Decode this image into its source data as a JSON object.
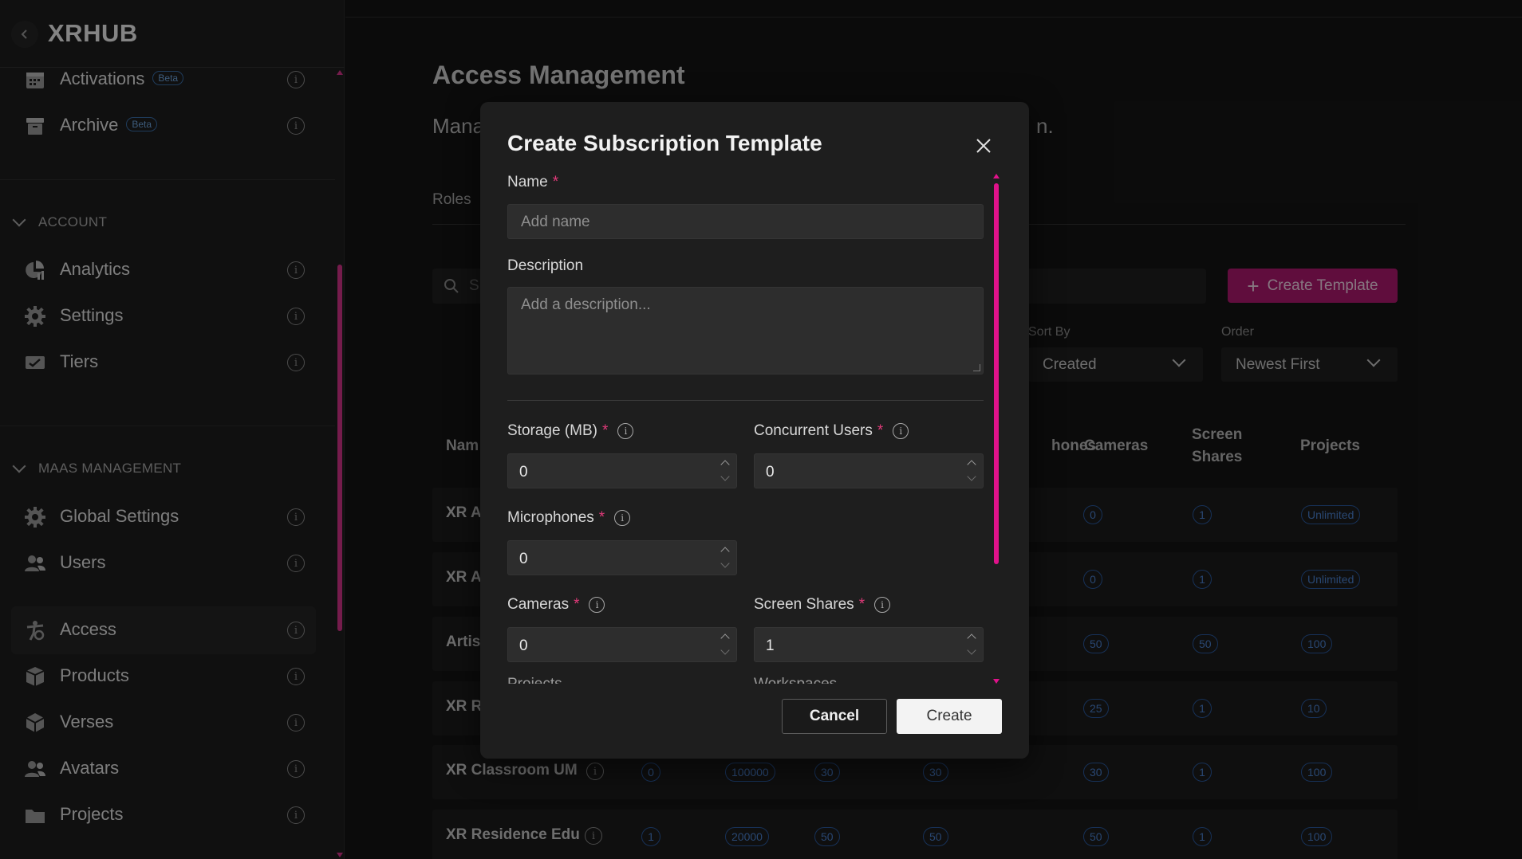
{
  "sidebar": {
    "brand": "XRHUB",
    "items_top": [
      {
        "label": "Activations",
        "badge": "Beta",
        "icon": "calendar-icon"
      },
      {
        "label": "Archive",
        "badge": "Beta",
        "icon": "archive-box-icon"
      }
    ],
    "account_header": "ACCOUNT",
    "account_items": [
      {
        "label": "Analytics",
        "icon": "pie-chart-icon"
      },
      {
        "label": "Settings",
        "icon": "gear-icon"
      },
      {
        "label": "Tiers",
        "icon": "ticket-icon"
      }
    ],
    "maas_header": "MAAS MANAGEMENT",
    "maas_items": [
      {
        "label": "Global Settings",
        "icon": "gear-icon"
      },
      {
        "label": "Users",
        "icon": "users-icon"
      },
      {
        "label": "Access",
        "icon": "accessibility-icon",
        "active": true
      },
      {
        "label": "Products",
        "icon": "boxes-icon"
      },
      {
        "label": "Verses",
        "icon": "cube-icon"
      },
      {
        "label": "Avatars",
        "icon": "users-icon"
      },
      {
        "label": "Projects",
        "icon": "folder-icon"
      }
    ]
  },
  "main": {
    "title": "Access Management",
    "subtitle_start": "Mana",
    "subtitle_end": "n.",
    "tab_roles": "Roles",
    "search_placeholder": "S",
    "create_template_label": "Create Template",
    "sort_by_label": "Sort By",
    "sort_by_value": "Created",
    "order_label": "Order",
    "order_value": "Newest First",
    "columns": {
      "name": "Nam",
      "microphones": "hones",
      "cameras": "Cameras",
      "screen_shares": "Screen Shares",
      "projects": "Projects"
    },
    "rows": [
      {
        "name": "XR A",
        "cameras": "0",
        "screen_shares": "1",
        "projects": "Unlimited"
      },
      {
        "name": "XR A",
        "cameras": "0",
        "screen_shares": "1",
        "projects": "Unlimited"
      },
      {
        "name": "Artis",
        "cameras": "50",
        "screen_shares": "50",
        "projects": "100"
      },
      {
        "name": "XR R",
        "cameras": "25",
        "screen_shares": "1",
        "projects": "10"
      },
      {
        "name": "XR Classroom UM",
        "storage": "0",
        "concurrent": "100000",
        "c3": "30",
        "microphones": "30",
        "cameras": "30",
        "screen_shares": "1",
        "projects": "100"
      },
      {
        "name": "XR Residence Edu",
        "storage": "1",
        "concurrent": "20000",
        "c3": "50",
        "microphones": "50",
        "cameras": "50",
        "screen_shares": "1",
        "projects": "100"
      }
    ]
  },
  "modal": {
    "title": "Create Subscription Template",
    "name_label": "Name",
    "name_placeholder": "Add name",
    "description_label": "Description",
    "description_placeholder": "Add a description...",
    "required_mark": "*",
    "storage_label": "Storage (MB)",
    "storage_value": "0",
    "concurrent_label": "Concurrent Users",
    "concurrent_value": "0",
    "microphones_label": "Microphones",
    "microphones_value": "0",
    "cameras_label": "Cameras",
    "cameras_value": "0",
    "screen_shares_label": "Screen Shares",
    "screen_shares_value": "1",
    "cut_left": "Projects",
    "cut_right": "Workspaces",
    "cancel_label": "Cancel",
    "create_label": "Create"
  },
  "colors": {
    "accent": "#b0186f",
    "scroll_accent": "#e0128a",
    "pill_blue": "#2a5aa0"
  }
}
